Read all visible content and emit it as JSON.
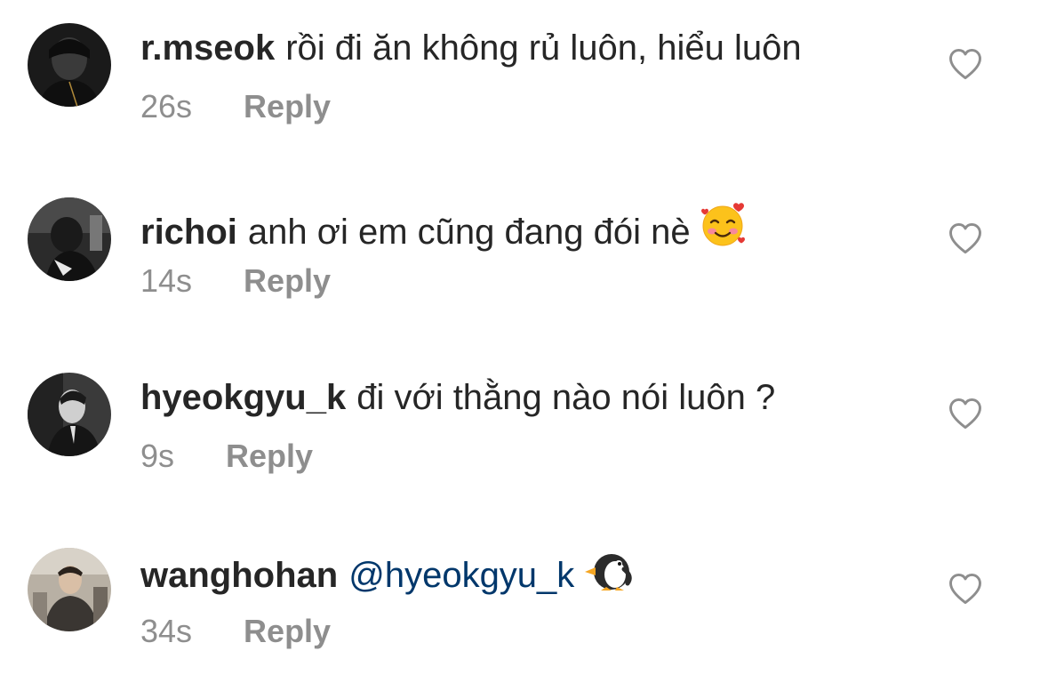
{
  "comments": [
    {
      "username": "r.mseok",
      "text": "rồi đi ăn không rủ luôn, hiểu luôn",
      "time": "26s",
      "reply_label": "Reply",
      "avatar_icon": "profile-photo-dark"
    },
    {
      "username": "richoi",
      "text": "anh ơi em cũng đang đói nè",
      "emoji": "smiling-face-with-hearts",
      "time": "14s",
      "reply_label": "Reply",
      "avatar_icon": "profile-photo-bw"
    },
    {
      "username": "hyeokgyu_k",
      "text": "đi với thằng nào nói luôn ?",
      "time": "9s",
      "reply_label": "Reply",
      "avatar_icon": "profile-photo-gray"
    },
    {
      "username": "wanghohan",
      "mention": "@hyeokgyu_k",
      "emoji": "penguin",
      "time": "34s",
      "reply_label": "Reply",
      "avatar_icon": "profile-photo-light"
    }
  ],
  "colors": {
    "text": "#262626",
    "secondary": "#8e8e8e",
    "mention": "#00376b"
  },
  "icons": {
    "like": "heart-outline-icon"
  }
}
